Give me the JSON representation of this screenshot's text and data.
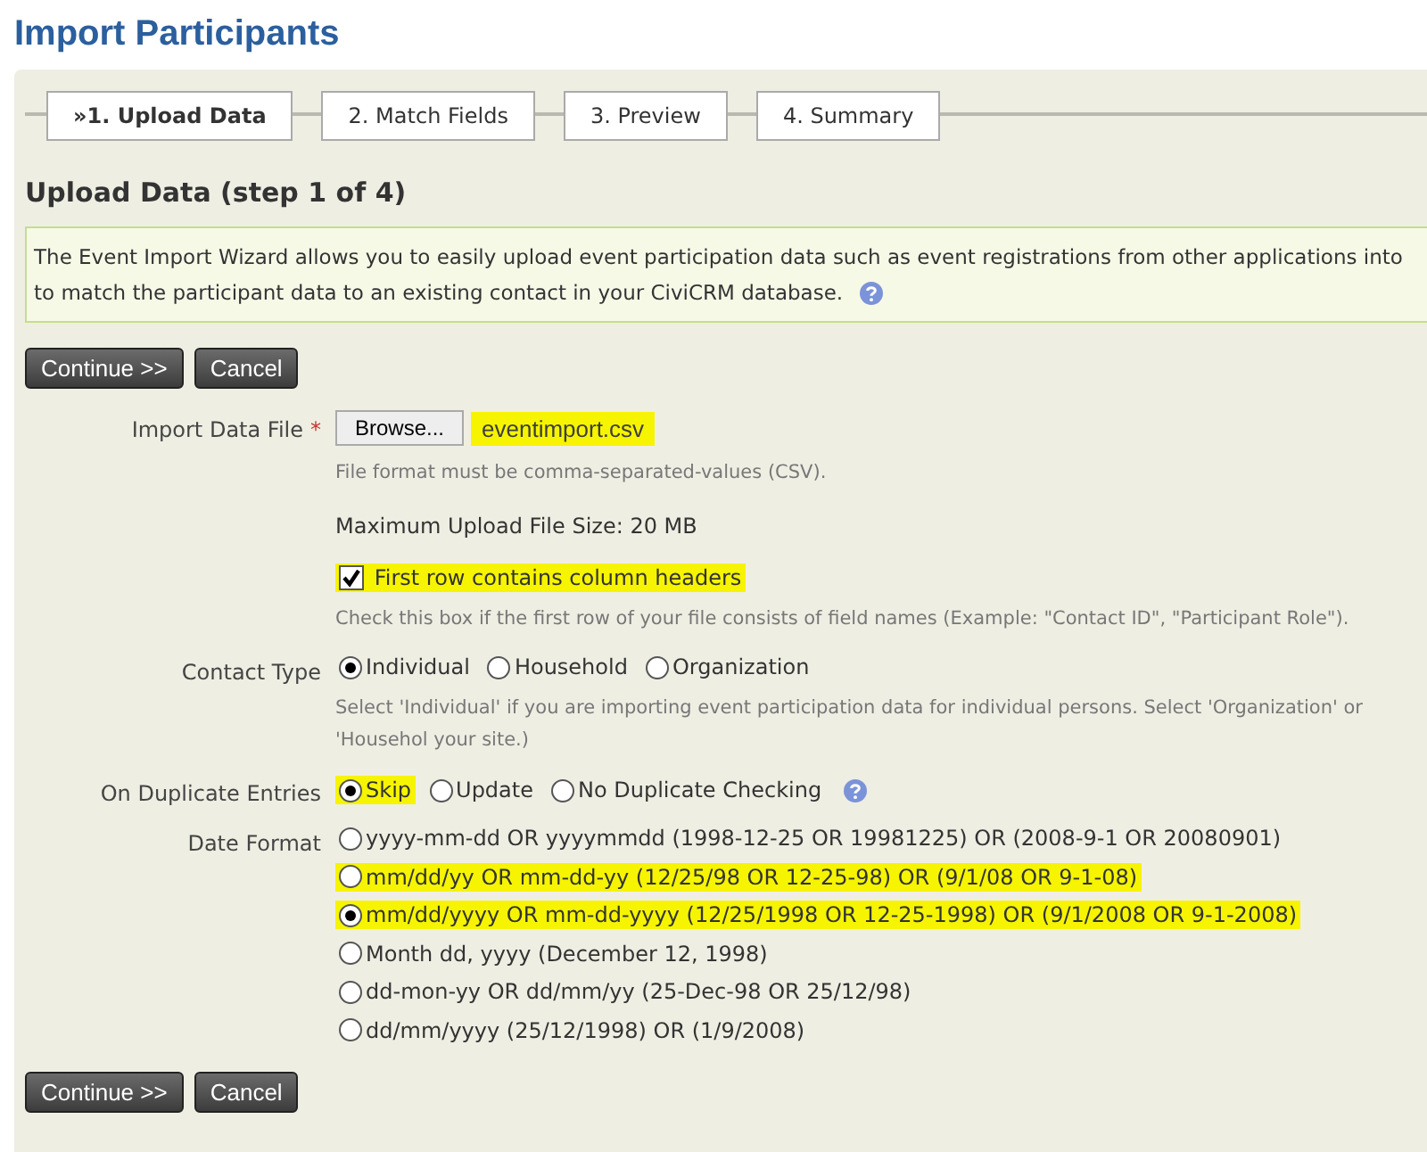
{
  "page_title": "Import Participants",
  "tabs": [
    {
      "label": "»1. Upload Data",
      "selected": true
    },
    {
      "label": "2. Match Fields",
      "selected": false
    },
    {
      "label": "3. Preview",
      "selected": false
    },
    {
      "label": "4. Summary",
      "selected": false
    }
  ],
  "step_heading": "Upload Data (step 1 of 4)",
  "intro_lines": [
    "The Event Import Wizard allows you to easily upload event participation data such as event registrations from other applications into",
    "to match the participant data to an existing contact in your CiviCRM database."
  ],
  "top_buttons": [
    "Continue >>",
    "Cancel"
  ],
  "import_file": {
    "label": "Import Data File",
    "required_mark": "*",
    "browse": "Browse...",
    "value": "eventimport.csv",
    "highlighted": true,
    "help": "File format must be comma-separated-values (CSV).",
    "max_size": "Maximum Upload File Size: 20 MB"
  },
  "header_checkbox": {
    "label": "First row contains column headers",
    "checked": true,
    "highlighted": true,
    "help": "Check this box if the first row of your file consists of field names (Example: \"Contact ID\", \"Participant Role\")."
  },
  "contact_type": {
    "label": "Contact Type",
    "options": [
      {
        "label": "Individual",
        "selected": true,
        "highlighted": false
      },
      {
        "label": "Household",
        "selected": false,
        "highlighted": false
      },
      {
        "label": "Organization",
        "selected": false,
        "highlighted": false
      }
    ],
    "help": "Select 'Individual' if you are importing event participation data for individual persons. Select 'Organization' or 'Househol your site.)"
  },
  "duplicates": {
    "label": "On Duplicate Entries",
    "options": [
      {
        "label": "Skip",
        "selected": true,
        "highlighted": true
      },
      {
        "label": "Update",
        "selected": false,
        "highlighted": false
      },
      {
        "label": "No Duplicate Checking",
        "selected": false,
        "highlighted": false
      }
    ]
  },
  "date_format": {
    "label": "Date Format",
    "options": [
      {
        "label": "yyyy-mm-dd OR yyyymmdd (1998-12-25 OR 19981225) OR (2008-9-1 OR 20080901)",
        "selected": false,
        "highlighted": false
      },
      {
        "label": "mm/dd/yy OR mm-dd-yy (12/25/98 OR 12-25-98) OR (9/1/08 OR 9-1-08)",
        "selected": false,
        "highlighted": true
      },
      {
        "label": "mm/dd/yyyy OR mm-dd-yyyy (12/25/1998 OR 12-25-1998) OR (9/1/2008 OR 9-1-2008)",
        "selected": true,
        "highlighted": true
      },
      {
        "label": "Month dd, yyyy (December 12, 1998)",
        "selected": false,
        "highlighted": false
      },
      {
        "label": "dd-mon-yy OR dd/mm/yy (25-Dec-98 OR 25/12/98)",
        "selected": false,
        "highlighted": false
      },
      {
        "label": "dd/mm/yyyy (25/12/1998) OR (1/9/2008)",
        "selected": false,
        "highlighted": false
      }
    ]
  },
  "bottom_buttons": [
    "Continue >>",
    "Cancel"
  ]
}
